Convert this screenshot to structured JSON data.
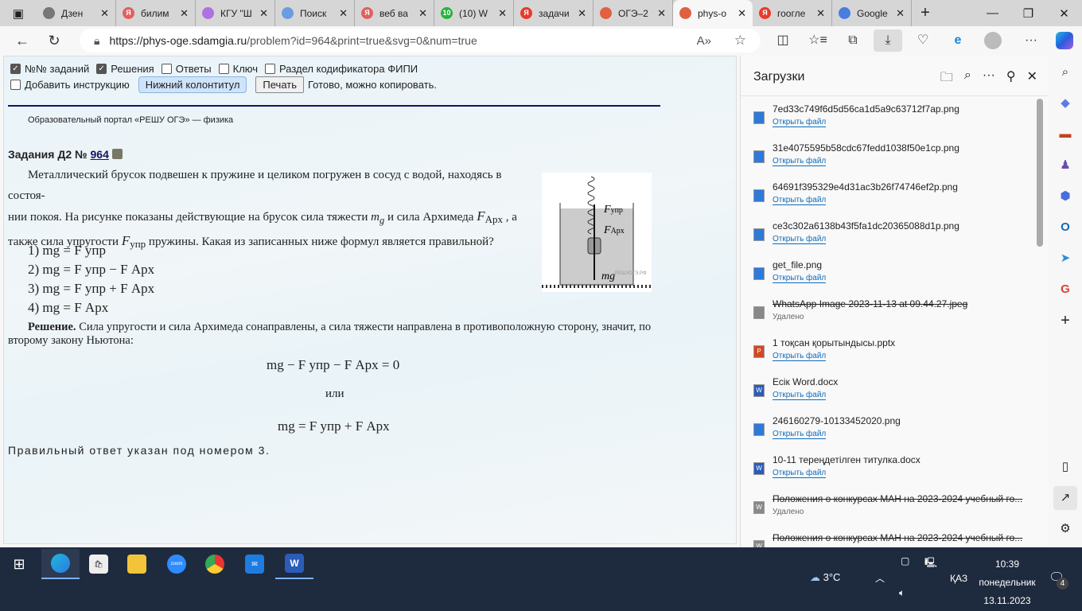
{
  "tabs": [
    {
      "label": "Дзен",
      "color": "#777"
    },
    {
      "label": "билим",
      "color": "#e06060"
    },
    {
      "label": "КГУ \"Ш",
      "color": "#b070e0"
    },
    {
      "label": "Поиск",
      "color": "#6a9de0"
    },
    {
      "label": "веб ва",
      "color": "#e06060"
    },
    {
      "label": "(10) W",
      "color": "#25b33c"
    },
    {
      "label": "задачи",
      "color": "#e83a2a"
    },
    {
      "label": "ОГЭ–2",
      "color": "#e06040"
    },
    {
      "label": "phys-o",
      "color": "#e06040"
    },
    {
      "label": "гоогле",
      "color": "#e83a2a"
    },
    {
      "label": "Google",
      "color": "#4a7de0"
    }
  ],
  "whatsapp_badge": "10",
  "yandex_letter": "Я",
  "address": {
    "host": "https://phys-oge.sdamgia.ru",
    "path": "/problem?id=964&print=true&svg=0&num=true"
  },
  "options": {
    "nums": "№№ заданий",
    "solutions": "Решения",
    "answers": "Ответы",
    "key": "Ключ",
    "codifier": "Раздел кодификатора ФИПИ",
    "instruction": "Добавить инструкцию",
    "footer_btn": "Нижний колонтитул",
    "print_btn": "Печать",
    "status": "Готово, можно копировать."
  },
  "portal": "Образовательный портал «РЕШУ ОГЭ» — физика",
  "task": {
    "heading": "Задания Д2 №",
    "number": "964",
    "text1": "Металлический брусок подвешен к пружине и целиком погружен в сосуд с водой, находясь в состоя-",
    "text2a": "нии покоя. На рисунке показаны действующие на брусок сила тяжести",
    "text2b": "и сила Архимеда",
    "text2c": ", а",
    "text3a": "также сила упругости",
    "text3b": "пружины. Какая из записанных ниже формул является правильной?",
    "mg": "m",
    "g": "g",
    "F": "F",
    "upr": "упр",
    "arh": "Арх",
    "options": [
      "1) mg = F упр",
      "2) mg = F упр − F Арх",
      "3) mg = F упр + F Арх",
      "4) mg = F Арх"
    ],
    "solution_label": "Решение.",
    "solution_text": "Сила упругости и сила Архимеда сонаправлены, а сила тяжести направлена в противоположную сторону, значит, по второму закону Ньютона:",
    "eq1": "mg − F упр − F Арх = 0",
    "or": "или",
    "eq2": "mg = F упр + F Арх",
    "answer": "Правильный ответ указан под номером 3.",
    "figure_watermark": "РЕШУОГЭ.РФ"
  },
  "downloads": {
    "title": "Загрузки",
    "items": [
      {
        "name": "7ed33c749f6d5d56ca1d5a9c63712f7ap.png",
        "status": "Открыть файл",
        "type": "img"
      },
      {
        "name": "31e4075595b58cdc67fedd1038f50e1cp.png",
        "status": "Открыть файл",
        "type": "img"
      },
      {
        "name": "64691f395329e4d31ac3b26f74746ef2p.png",
        "status": "Открыть файл",
        "type": "img"
      },
      {
        "name": "ce3c302a6138b43f5fa1dc20365088d1p.png",
        "status": "Открыть файл",
        "type": "img"
      },
      {
        "name": "get_file.png",
        "status": "Открыть файл",
        "type": "img"
      },
      {
        "name": "WhatsApp Image 2023-11-13 at 09.44.27.jpeg",
        "status": "Удалено",
        "type": "img",
        "deleted": true
      },
      {
        "name": "1 тоқсан қорытындысы.pptx",
        "status": "Открыть файл",
        "type": "ppt"
      },
      {
        "name": "Есік Word.docx",
        "status": "Открыть файл",
        "type": "word"
      },
      {
        "name": "246160279-10133452020.png",
        "status": "Открыть файл",
        "type": "img"
      },
      {
        "name": "10-11 тереңдетілген титулка.docx",
        "status": "Открыть файл",
        "type": "word"
      },
      {
        "name": "Положения о конкурсах МАН на 2023-2024 учебный го...",
        "status": "Удалено",
        "type": "word",
        "deleted": true
      },
      {
        "name": "Положения о конкурсах МАН на 2023-2024 учебный го...",
        "status": "",
        "type": "word",
        "deleted": true
      }
    ]
  },
  "tray": {
    "weather": "3°C",
    "lang": "ҚАЗ",
    "time": "10:39",
    "day": "понедельник",
    "date": "13.11.2023",
    "notifications": "4",
    "zoom_label": "zoom"
  }
}
